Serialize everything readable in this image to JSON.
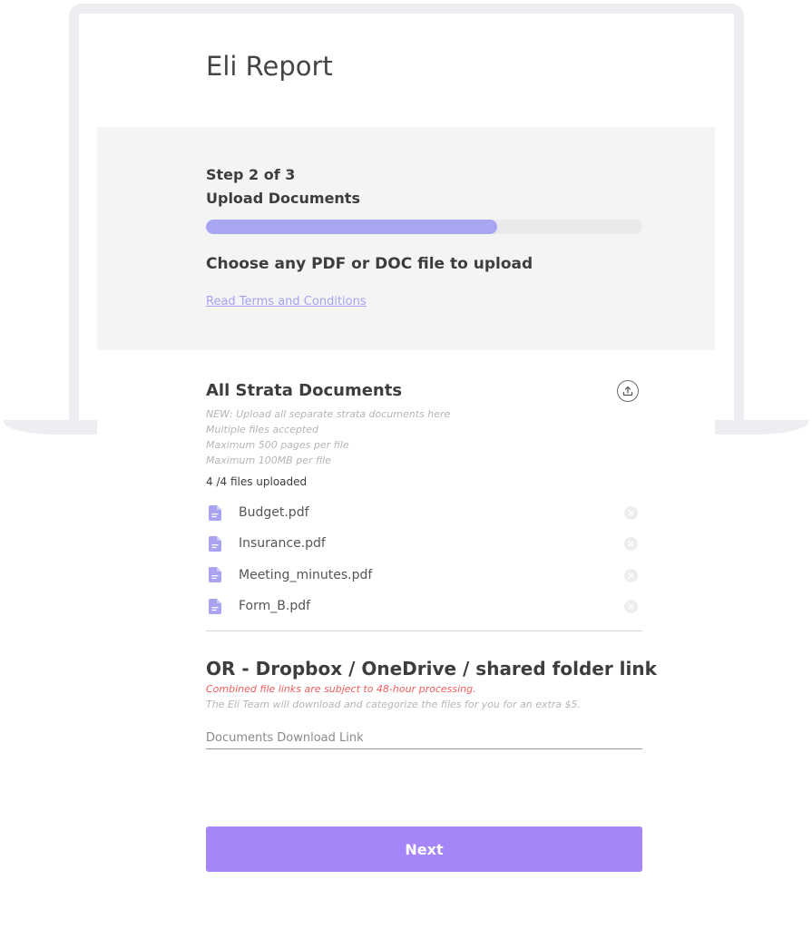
{
  "page": {
    "title": "Eli Report"
  },
  "step": {
    "count_label": "Step 2 of 3",
    "name": "Upload Documents",
    "progress_fraction": 0.667,
    "instruction": "Choose any PDF or DOC file to upload",
    "terms_link": "Read Terms and Conditions"
  },
  "documents": {
    "title": "All Strata Documents",
    "notes": [
      "NEW: Upload all separate strata documents here",
      "Multiple files accepted",
      "Maximum 500 pages per file",
      "Maximum 100MB per file"
    ],
    "count_text": "4 /4 files uploaded",
    "files": [
      {
        "name": "Budget.pdf"
      },
      {
        "name": "Insurance.pdf"
      },
      {
        "name": "Meeting_minutes.pdf"
      },
      {
        "name": "Form_B.pdf"
      }
    ]
  },
  "link_section": {
    "title": "OR - Dropbox / OneDrive / shared folder link",
    "warning": "Combined file links are subject to 48-hour processing.",
    "note": "The Eli Team will download and categorize the files for you for an extra $5.",
    "placeholder": "Documents Download Link",
    "value": ""
  },
  "actions": {
    "next_label": "Next"
  },
  "colors": {
    "accent": "#a685f8",
    "progress": "#a8a5f3",
    "link": "#a6a2f1",
    "warning": "#f05d5d",
    "file_icon": "#a9a3f2"
  },
  "icons": {
    "upload": "upload-icon",
    "file": "file-document-icon",
    "remove": "close-circle-icon"
  }
}
